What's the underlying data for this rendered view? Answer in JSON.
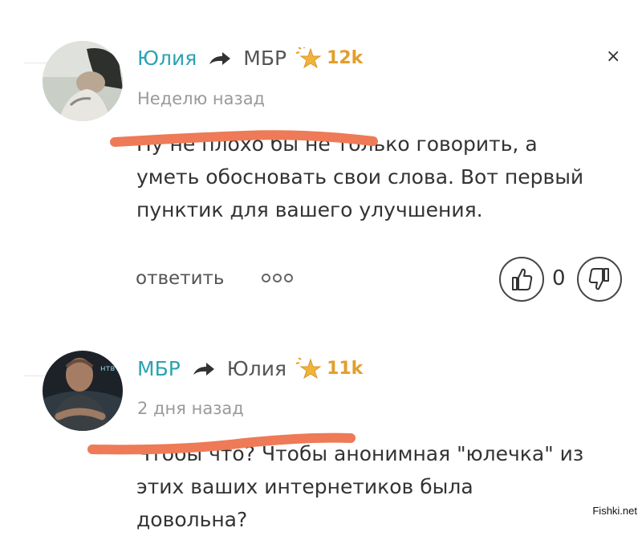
{
  "comments": [
    {
      "author": "Юлия",
      "recipient": "МБР",
      "rating": "12k",
      "timestamp": "Неделю назад",
      "lines": [
        "Ну не плохо бы не только говорить, а",
        "уметь обосновать свои слова. Вот первый",
        "пунктик для вашего улучшения."
      ],
      "reply_label": "ответить",
      "vote_count": "0"
    },
    {
      "author": "МБР",
      "recipient": "Юлия",
      "rating": "11k",
      "timestamp": "2 дня назад",
      "lines": [
        "Чтобы что? Чтобы анонимная \"юлечка\" из",
        "этих ваших интернетиков была",
        "довольна?"
      ]
    }
  ],
  "close_symbol": "×",
  "watermark": "Fishki.net",
  "colors": {
    "author": "#2aa3b2",
    "rating": "#e39e2a",
    "strike": "#ee7a57"
  },
  "icons": [
    "reply-arrow-icon",
    "star-icon",
    "thumbs-up-icon",
    "thumbs-down-icon",
    "close-icon",
    "more-dots-icon"
  ]
}
